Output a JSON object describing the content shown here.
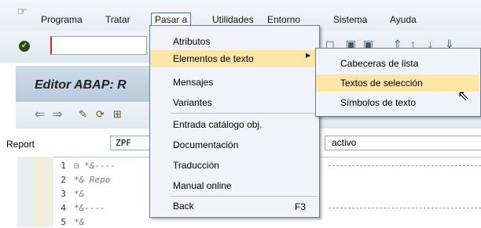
{
  "menubar": {
    "items": [
      {
        "label": "Programa"
      },
      {
        "label": "Tratar"
      },
      {
        "label": "Pasar a"
      },
      {
        "label": "Utilidades"
      },
      {
        "label": "Entorno"
      },
      {
        "label": "Sistema"
      },
      {
        "label": "Ayuda"
      }
    ]
  },
  "title": "Editor ABAP: R",
  "report": {
    "label": "Report",
    "value": "ZPF",
    "status": "activo"
  },
  "editor": {
    "lines": [
      {
        "no": "1",
        "text": "⊟ *&----"
      },
      {
        "no": "2",
        "text": "*& Repo"
      },
      {
        "no": "3",
        "text": "*&"
      },
      {
        "no": "4",
        "text": "*&----"
      },
      {
        "no": "5",
        "text": "*&"
      }
    ]
  },
  "dropdown": {
    "items": [
      {
        "label": "Atributos"
      },
      {
        "label": "Elementos de texto"
      },
      {
        "label": "Mensajes"
      },
      {
        "label": "Variantes"
      },
      {
        "label": "Entrada catálogo obj."
      },
      {
        "label": "Documentación"
      },
      {
        "label": "Traducción"
      },
      {
        "label": "Manual online"
      },
      {
        "label": "Back"
      }
    ],
    "back_shortcut": "F3"
  },
  "submenu": {
    "items": [
      {
        "label": "Cabeceras de lista"
      },
      {
        "label": "Textos de selección"
      },
      {
        "label": "Símbolos de texto"
      }
    ]
  },
  "colors": {
    "highlight": "#fbe6a7",
    "title_bg": "#cfdbe8"
  }
}
